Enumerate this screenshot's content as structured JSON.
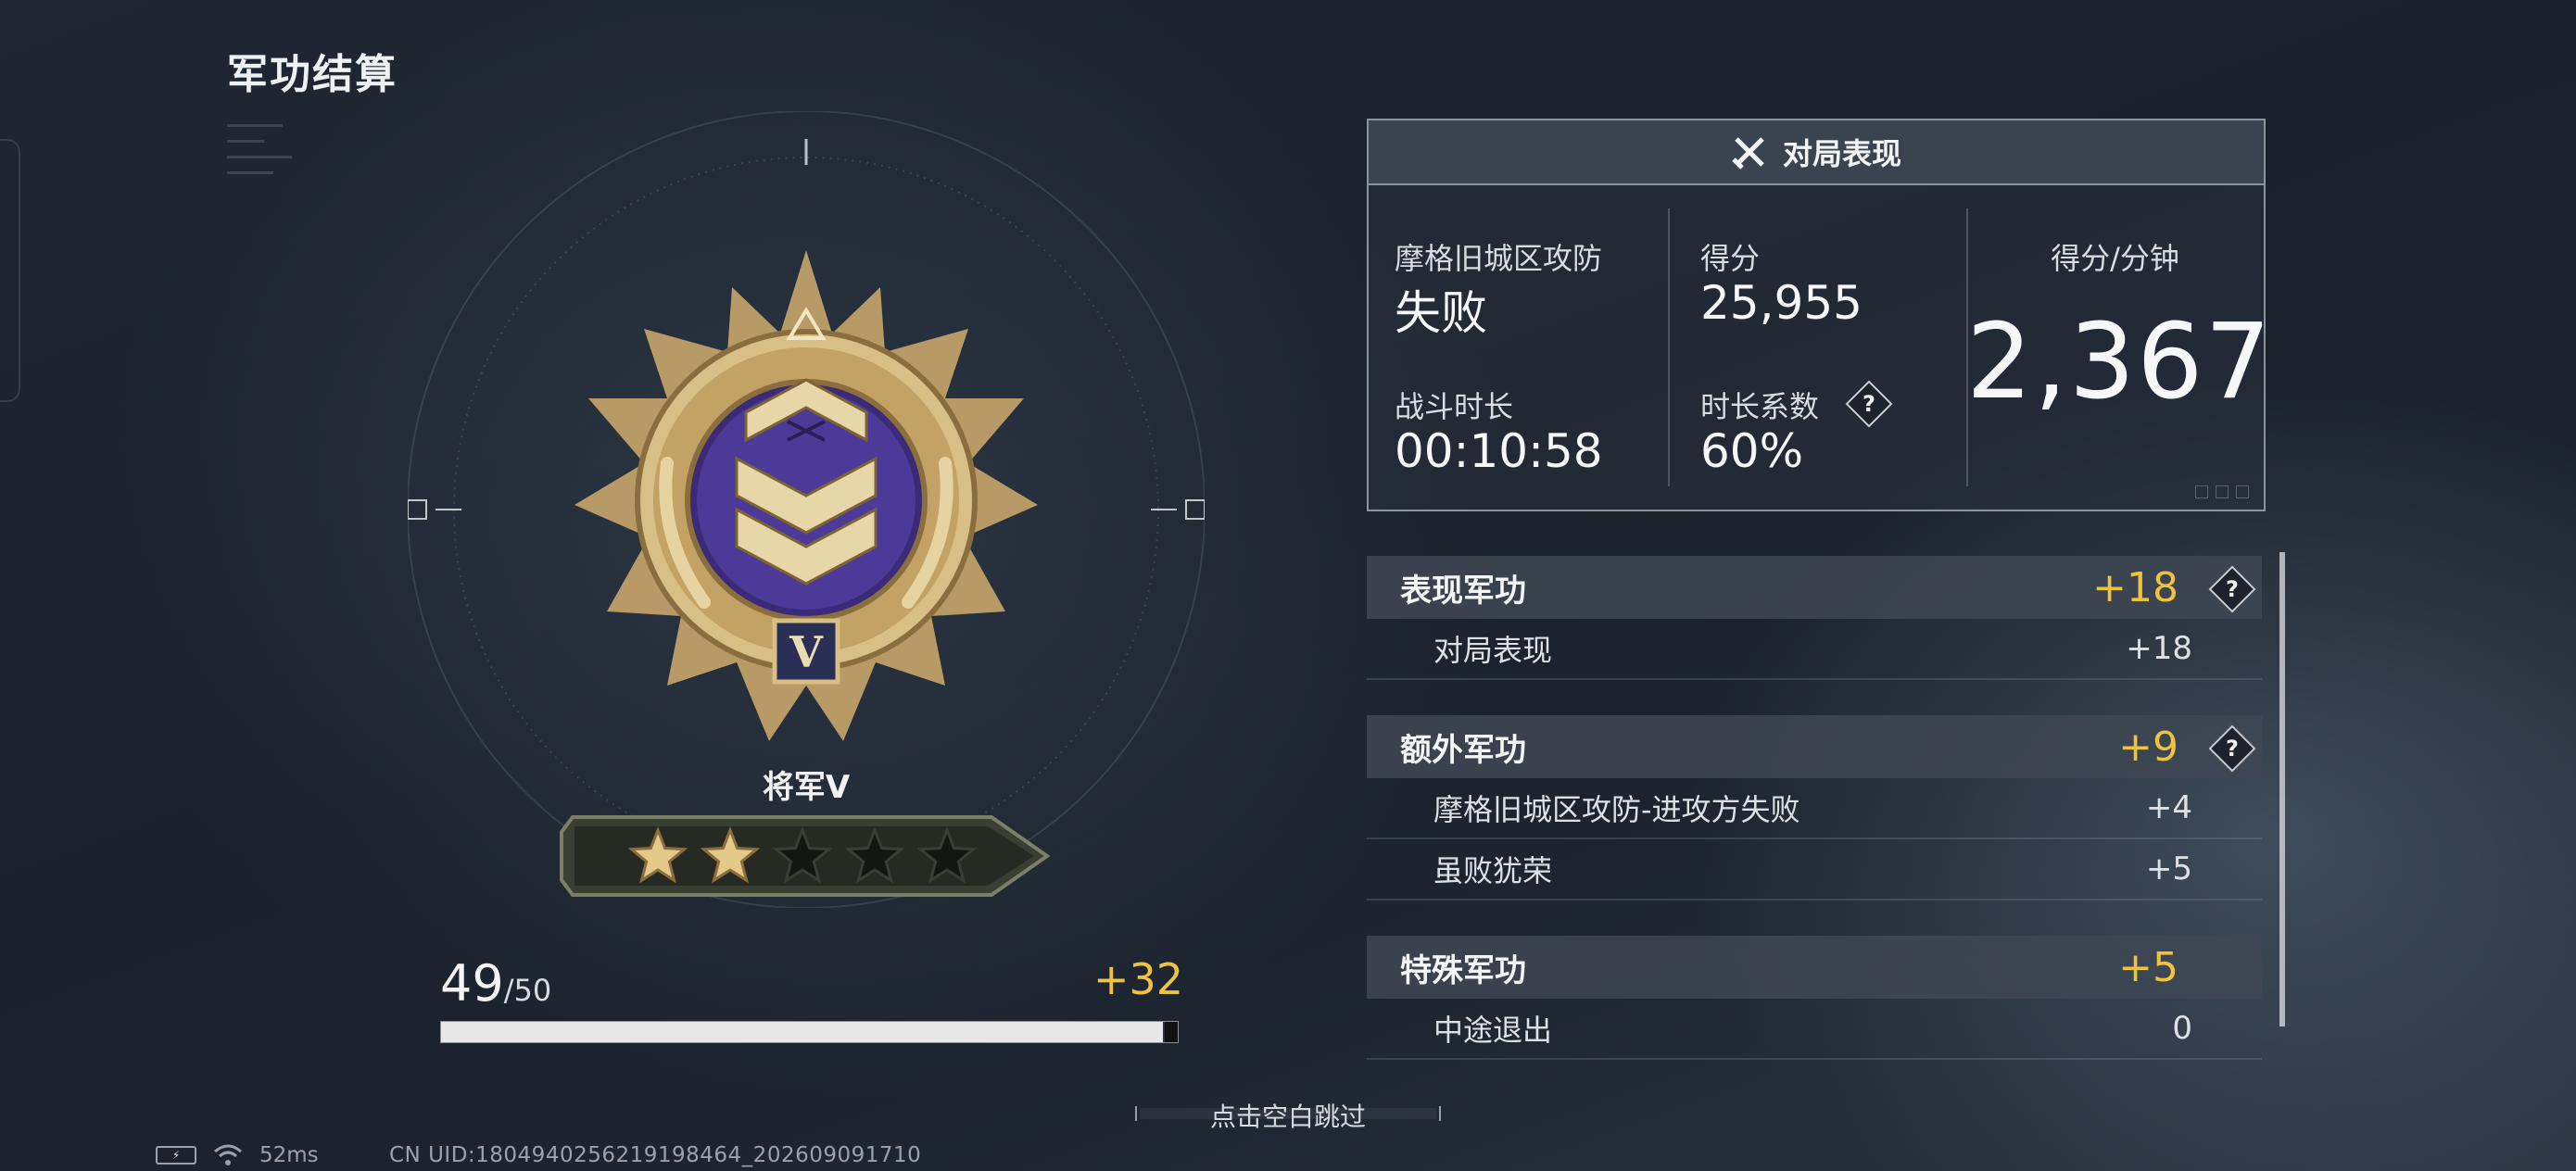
{
  "page": {
    "title": "军功结算"
  },
  "rank": {
    "name": "将军V",
    "numeral": "V",
    "stars_filled": 2,
    "stars_total": 5
  },
  "progress": {
    "current": "49",
    "max": "/50",
    "gain": "+32",
    "fraction": 0.98
  },
  "match": {
    "header": "对局表现",
    "mode": "摩格旧城区攻防",
    "result": "失败",
    "duration_label": "战斗时长",
    "duration": "00:10:58",
    "score_label": "得分",
    "score": "25,955",
    "factor_label": "时长系数",
    "factor": "60%",
    "spm_label": "得分/分钟",
    "spm": "2,367"
  },
  "merits": {
    "performance": {
      "title": "表现军功",
      "value": "+18",
      "items": [
        {
          "label": "对局表现",
          "value": "+18"
        }
      ]
    },
    "extra": {
      "title": "额外军功",
      "value": "+9",
      "items": [
        {
          "label": "摩格旧城区攻防-进攻方失败",
          "value": "+4"
        },
        {
          "label": "虽败犹荣",
          "value": "+5"
        }
      ]
    },
    "special": {
      "title": "特殊军功",
      "value": "+5",
      "items": [
        {
          "label": "中途退出",
          "value": "0"
        }
      ]
    }
  },
  "help_glyph": "?",
  "footer": {
    "skip_hint": "点击空白跳过",
    "ping": "52ms",
    "uid": "CN UID:1804940256219198464_202609091710"
  },
  "colors": {
    "accent_gold": "#f0c33d",
    "background": "#1c2530",
    "panel_border": "#8c949d"
  },
  "icons": [
    "battery-icon",
    "wifi-icon",
    "crossed-swords-icon",
    "help-icon",
    "star-icon",
    "medal-emblem-icon"
  ]
}
